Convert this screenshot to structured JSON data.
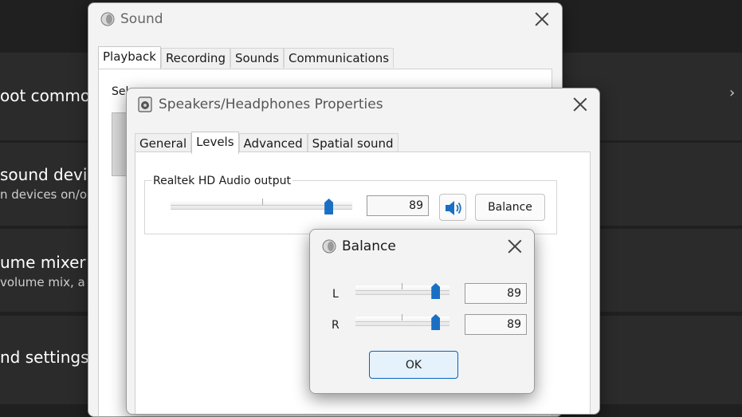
{
  "background": {
    "rows": [
      {
        "title": "oot common",
        "subtitle": ""
      },
      {
        "title": "sound device",
        "subtitle": "n devices on/o"
      },
      {
        "title": "ume mixer",
        "subtitle": "volume mix, a"
      },
      {
        "title": "nd settings",
        "subtitle": ""
      }
    ]
  },
  "sound_window": {
    "title": "Sound",
    "tabs": [
      "Playback",
      "Recording",
      "Sounds",
      "Communications"
    ],
    "active_tab": "Playback",
    "instruction_partial": "Sel"
  },
  "properties_window": {
    "title": "Speakers/Headphones Properties",
    "tabs": [
      "General",
      "Levels",
      "Advanced",
      "Spatial sound"
    ],
    "active_tab": "Levels",
    "device_label": "Realtek HD Audio output",
    "volume_value": "89",
    "volume_level": 89,
    "balance_button": "Balance"
  },
  "balance_dialog": {
    "title": "Balance",
    "left_label": "L",
    "left_value": "89",
    "left_level": 89,
    "right_label": "R",
    "right_value": "89",
    "right_level": 89,
    "ok_button": "OK"
  },
  "colors": {
    "accent": "#1a6fc4",
    "background": "#202020"
  },
  "icons": {
    "window": "speaker-icon",
    "mute_toggle": "speaker-volume-icon"
  }
}
